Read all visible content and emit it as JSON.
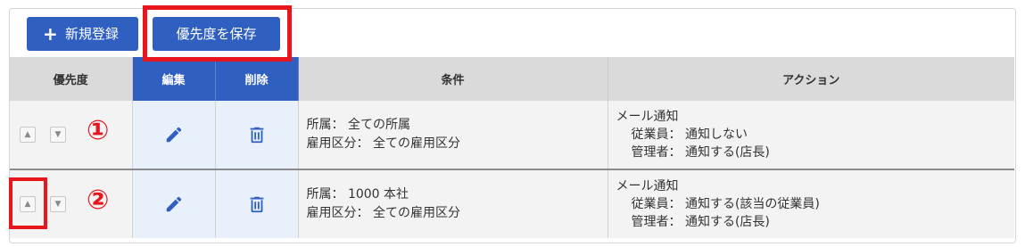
{
  "toolbar": {
    "new_button": "新規登録",
    "save_priority_button": "優先度を保存"
  },
  "table": {
    "headers": {
      "priority": "優先度",
      "edit": "編集",
      "delete": "削除",
      "condition": "条件",
      "action": "アクション"
    },
    "rows": [
      {
        "marker": "①",
        "condition": {
          "line1": "所属： 全ての所属",
          "line2": "雇用区分： 全ての雇用区分"
        },
        "action": {
          "title": "メール通知",
          "line1": "従業員： 通知しない",
          "line2": "管理者： 通知する(店長)"
        }
      },
      {
        "marker": "②",
        "condition": {
          "line1": "所属： 1000 本社",
          "line2": "雇用区分： 全ての雇用区分"
        },
        "action": {
          "title": "メール通知",
          "line1": "従業員： 通知する(該当の従業員)",
          "line2": "管理者： 通知する(店長)"
        }
      }
    ]
  },
  "colors": {
    "primary": "#2f5fc0",
    "highlight": "#e8151c",
    "row_bg": "#f3f3f3",
    "header_bg": "#dadada"
  },
  "icons": {
    "edit": "pencil-icon",
    "delete": "trash-icon",
    "up": "chevron-up-icon",
    "down": "chevron-down-icon",
    "add": "plus-icon"
  }
}
